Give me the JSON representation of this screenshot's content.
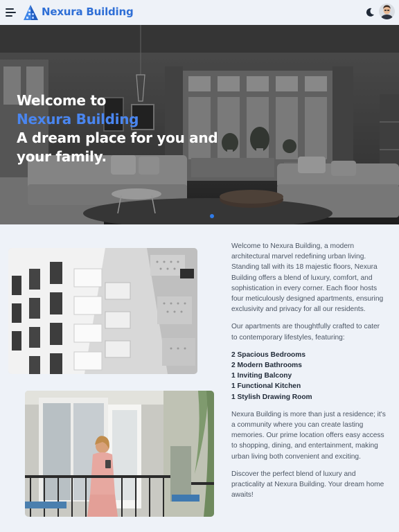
{
  "header": {
    "brand": "Nexura Building",
    "menu_icon": "hamburger-menu-icon",
    "theme_icon": "moon-icon",
    "avatar_icon": "user-avatar"
  },
  "hero": {
    "line1": "Welcome to",
    "line2": "Nexura Building",
    "line3": "A dream place for you and",
    "line4": "your family.",
    "accent_color": "#4a86f0",
    "active_slide": 1
  },
  "content": {
    "paragraphs": [
      "Welcome to Nexura Building, a modern architectural marvel redefining urban living. Standing tall with its 18 majestic floors, Nexura Building offers a blend of luxury, comfort, and sophistication in every corner. Each floor hosts four meticulously designed apartments, ensuring exclusivity and privacy for all our residents.",
      "Our apartments are thoughtfully crafted to cater to contemporary lifestyles, featuring:"
    ],
    "features": [
      "2 Spacious Bedrooms",
      "2 Modern Bathrooms",
      "1 Inviting Balcony",
      "1 Functional Kitchen",
      "1 Stylish Drawing Room"
    ],
    "closing": [
      "Nexura Building is more than just a residence; it's a community where you can create lasting memories. Our prime location offers easy access to shopping, dining, and entertainment, making urban living both convenient and exciting.",
      "Discover the perfect blend of luxury and practicality at Nexura Building. Your dream home awaits!"
    ]
  },
  "colors": {
    "brand": "#2f6fd6",
    "background": "#eef2f8",
    "dot_active": "#2f7be8"
  }
}
